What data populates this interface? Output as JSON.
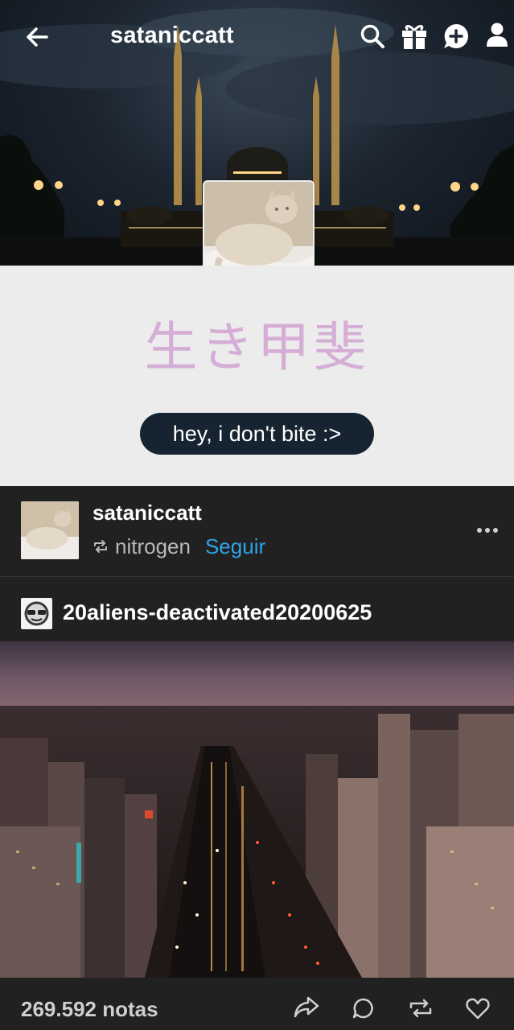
{
  "header": {
    "title": "sataniccatt",
    "icons": [
      "back-arrow-icon",
      "search-icon",
      "gift-icon",
      "message-icon",
      "account-icon"
    ]
  },
  "blog": {
    "title_kanji": "生き甲斐",
    "description": "hey, i don't bite :>"
  },
  "post": {
    "author": "sataniccatt",
    "reblog_from": "nitrogen",
    "follow_label": "Seguir",
    "source_blog": "20aliens-deactivated20200625",
    "notes_count": "269.592 notas",
    "actions": [
      "share-icon",
      "reply-icon",
      "reblog-icon",
      "like-icon"
    ]
  },
  "colors": {
    "kanji": "#d5aed6",
    "pill_bg": "#152430",
    "follow": "#2fa3e8",
    "post_bg": "#212121",
    "blog_bg": "#ececec"
  }
}
